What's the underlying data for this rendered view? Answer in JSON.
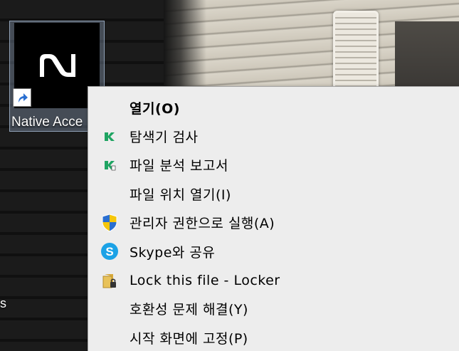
{
  "desktop": {
    "left_edge_text": "s",
    "icon": {
      "label": "Native Acce",
      "logo": "native-instruments-logo",
      "badge": "shortcut-arrow-icon"
    }
  },
  "context_menu": {
    "items": [
      {
        "label": "열기(O)",
        "icon": "",
        "bold": true
      },
      {
        "label": "탐색기 검사",
        "icon": "kaspersky-icon"
      },
      {
        "label": "파일 분석 보고서",
        "icon": "kaspersky-report-icon"
      },
      {
        "label": "파일 위치 열기(I)",
        "icon": ""
      },
      {
        "label": "관리자 권한으로 실행(A)",
        "icon": "uac-shield-icon"
      },
      {
        "label": "Skype와 공유",
        "icon": "skype-icon"
      },
      {
        "label": "Lock this file - Locker",
        "icon": "locker-folder-icon"
      },
      {
        "label": "호환성 문제 해결(Y)",
        "icon": ""
      },
      {
        "label": "시작 화면에 고정(P)",
        "icon": ""
      }
    ]
  },
  "colors": {
    "menu_bg": "#ededed",
    "kaspersky_green": "#1fa462",
    "uac_blue": "#2a6fd1",
    "uac_yellow": "#f5c60b",
    "skype_blue": "#1ba2e6"
  }
}
